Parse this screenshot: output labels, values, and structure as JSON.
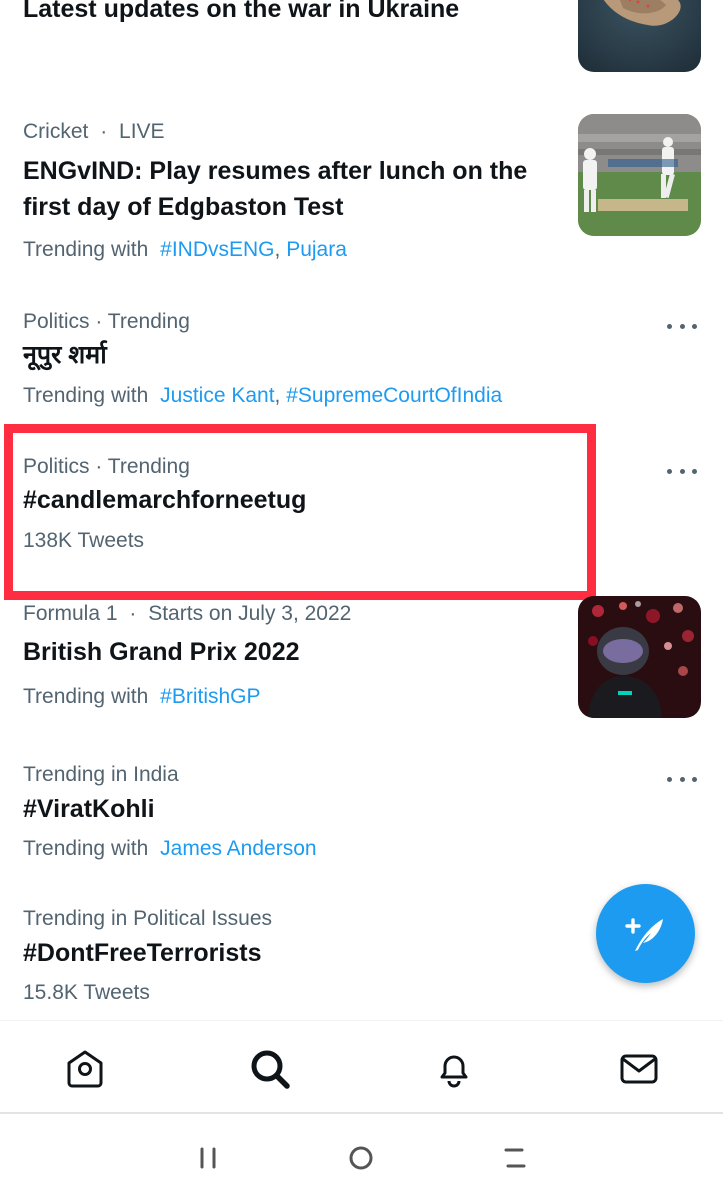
{
  "trends": [
    {
      "title": "Latest updates on the war in Ukraine",
      "has_image": true,
      "image_icon": "island-aerial-photo"
    },
    {
      "category": "Cricket",
      "status": "LIVE",
      "title_line1": "ENGvIND: Play resumes after lunch on the",
      "title_line2": "first day of Edgbaston Test",
      "trending_prefix": "Trending with",
      "links": [
        "#INDvsENG",
        "Pujara"
      ],
      "has_image": true,
      "image_icon": "cricket-match-photo"
    },
    {
      "meta": "Politics · Trending",
      "title": "नूपुर शर्मा",
      "trending_prefix": "Trending with",
      "links": [
        "Justice Kant",
        "#SupremeCourtOfIndia"
      ]
    },
    {
      "meta": "Politics · Trending",
      "title": "#candlemarchforneetug",
      "count": "138K Tweets",
      "highlighted": true
    },
    {
      "category": "Formula 1",
      "status": "Starts on July 3, 2022",
      "title": "British Grand Prix 2022",
      "trending_prefix": "Trending with",
      "links": [
        "#BritishGP"
      ],
      "has_image": true,
      "image_icon": "f1-driver-photo"
    },
    {
      "meta": "Trending in India",
      "title": "#ViratKohli",
      "trending_prefix": "Trending with",
      "links": [
        "James Anderson"
      ]
    },
    {
      "meta": "Trending in Political Issues",
      "title": "#DontFreeTerrorists",
      "count": "15.8K Tweets"
    }
  ],
  "separator": ",",
  "dot_separator": "·",
  "fab_icon": "compose-tweet-icon",
  "bottom_nav": [
    "home-icon",
    "search-icon",
    "bell-icon",
    "mail-icon"
  ],
  "system_nav": [
    "recent-apps-icon",
    "home-circle-icon",
    "back-icon"
  ],
  "colors": {
    "accent": "#1d9bf0",
    "highlight": "#ff2d42",
    "secondary_text": "#536471",
    "primary_text": "#0f1419"
  }
}
